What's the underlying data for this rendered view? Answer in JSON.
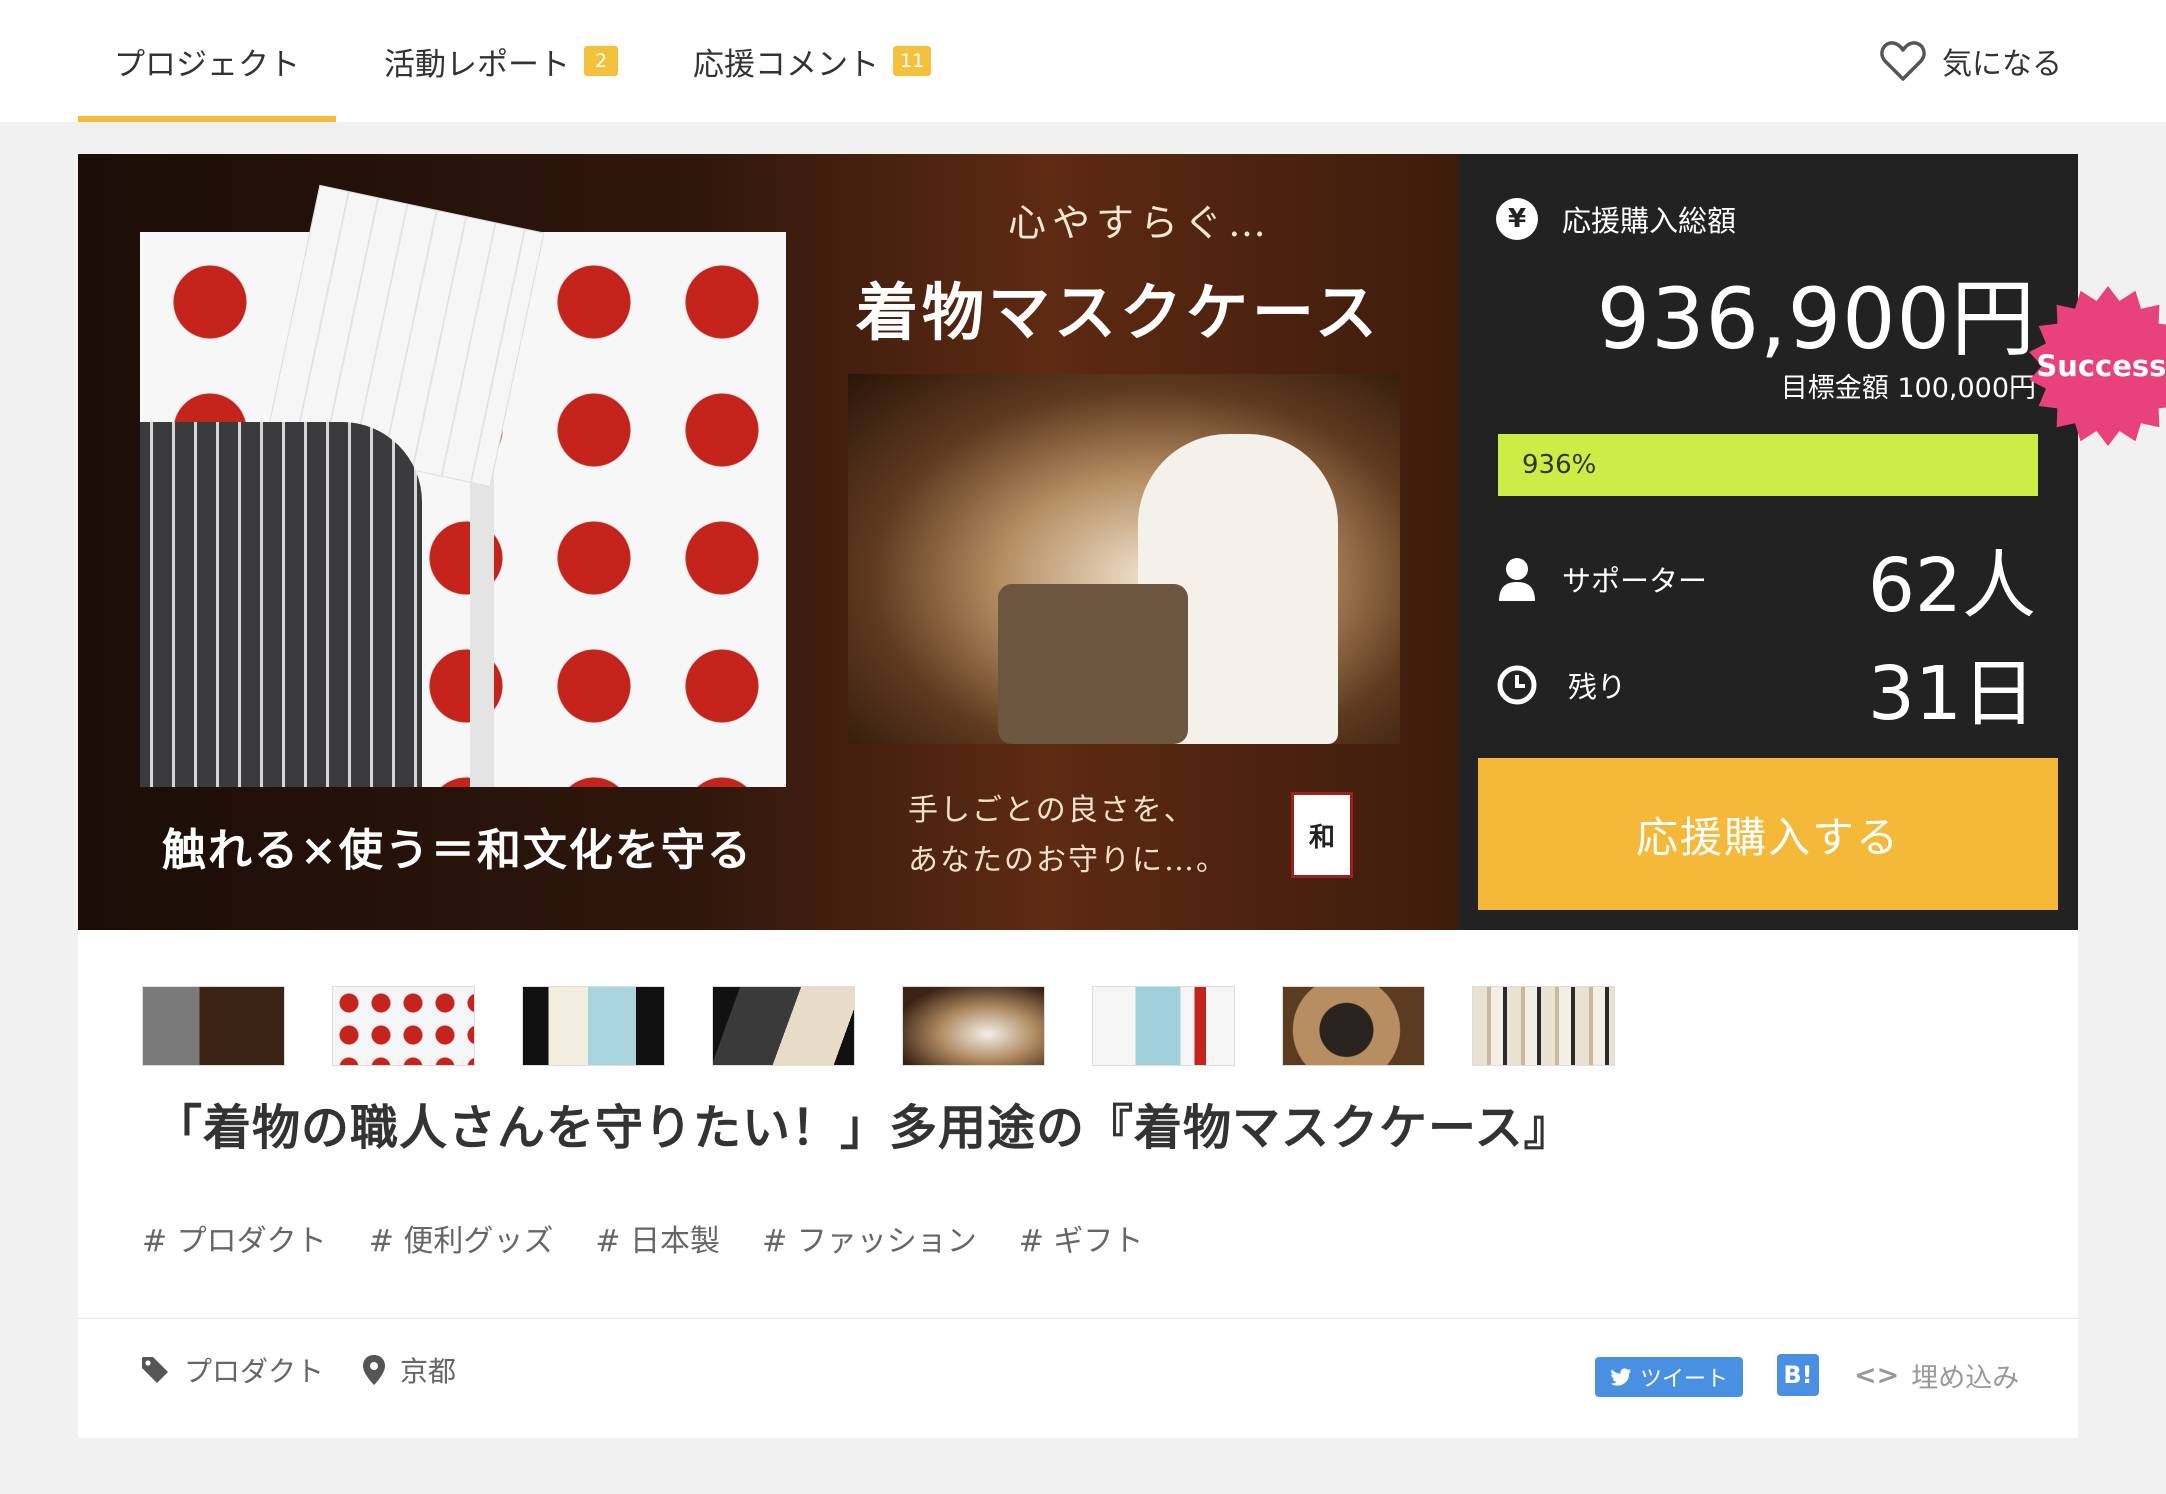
{
  "tabs": [
    {
      "label": "プロジェクト",
      "badge": null
    },
    {
      "label": "活動レポート",
      "badge": "2"
    },
    {
      "label": "応援コメント",
      "badge": "11"
    }
  ],
  "favorite_label": "気になる",
  "hero": {
    "subtitle": "心やすらぐ…",
    "title": "着物マスクケース",
    "caption_left": "触れる×使う＝和文化を守る",
    "caption_right_line1": "手しごとの良さを、",
    "caption_right_line2": "あなたのお守りに…。",
    "seal_text": "和"
  },
  "stats": {
    "total_label": "応援購入総額",
    "total_value": "936,900円",
    "target_text": "目標金額 100,000円",
    "progress_percent": 936,
    "progress_label": "936%",
    "supporters_label": "サポーター",
    "supporters_value": "62人",
    "remaining_label": "残り",
    "remaining_value": "31日",
    "buy_label": "応援購入する",
    "success_badge": "Success!"
  },
  "project_title": "「着物の職人さんを守りたい！」多用途の『着物マスクケース』",
  "tags": [
    "# プロダクト",
    "# 便利グッズ",
    "# 日本製",
    "# ファッション",
    "# ギフト"
  ],
  "footer": {
    "category": "プロダクト",
    "location": "京都",
    "tweet_label": "ツイート",
    "hatena_label": "B!",
    "embed_label": "埋め込み",
    "embed_code": "<>"
  },
  "colors": {
    "accent": "#f6bd3c",
    "progress": "#cbed46",
    "success": "#e8417c",
    "panel": "#222222",
    "share": "#4a90e2"
  }
}
